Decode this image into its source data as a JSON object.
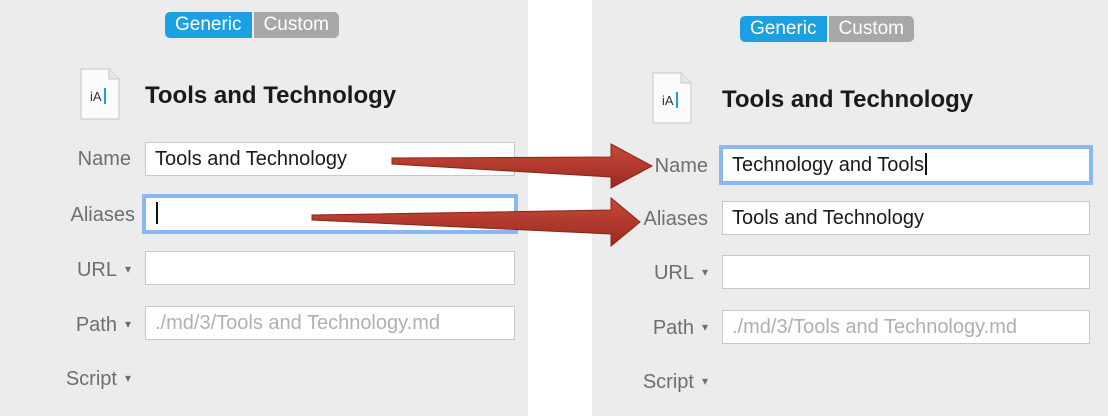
{
  "left": {
    "tabs": {
      "generic": "Generic",
      "custom": "Custom"
    },
    "icon_text": "iA",
    "title": "Tools and Technology",
    "labels": {
      "name": "Name",
      "aliases": "Aliases",
      "url": "URL",
      "path": "Path",
      "script": "Script"
    },
    "fields": {
      "name_value": "Tools and Technology",
      "aliases_value": "",
      "url_value": "",
      "path_placeholder": "./md/3/Tools and Technology.md"
    }
  },
  "right": {
    "tabs": {
      "generic": "Generic",
      "custom": "Custom"
    },
    "icon_text": "iA",
    "title": "Tools and Technology",
    "labels": {
      "name": "Name",
      "aliases": "Aliases",
      "url": "URL",
      "path": "Path",
      "script": "Script"
    },
    "fields": {
      "name_value": "Technology and Tools",
      "aliases_value": "Tools and Technology",
      "url_value": "",
      "path_placeholder": "./md/3/Tools and Technology.md"
    }
  },
  "colors": {
    "accent": "#1ba1e2",
    "arrow": "#b5362a",
    "focus_ring": "#8cb8f0"
  },
  "icons": {
    "dropdown": "▾"
  }
}
